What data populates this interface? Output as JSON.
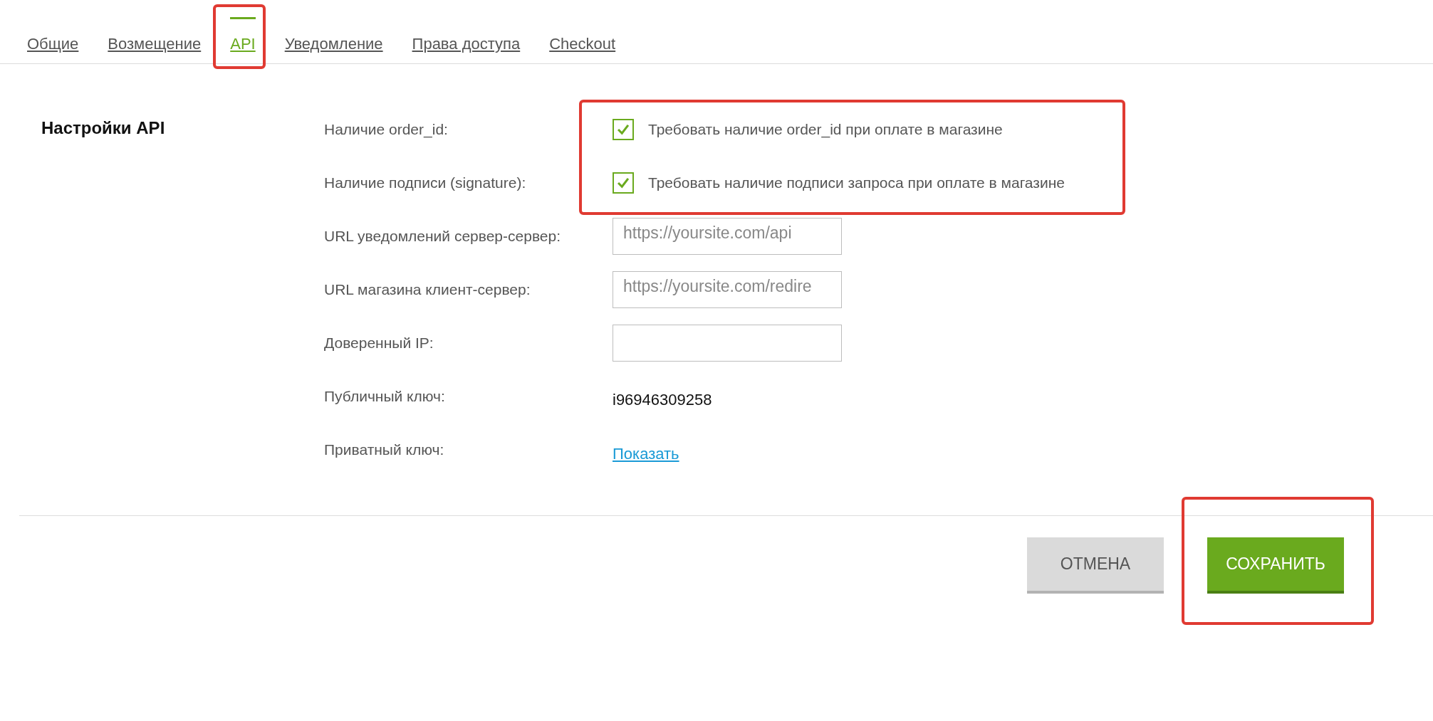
{
  "tabs": [
    {
      "label": "Общие",
      "selected": false,
      "highlighted": false
    },
    {
      "label": "Возмещение",
      "selected": false,
      "highlighted": false
    },
    {
      "label": "API",
      "selected": true,
      "highlighted": true
    },
    {
      "label": "Уведомление",
      "selected": false,
      "highlighted": false
    },
    {
      "label": "Права доступа",
      "selected": false,
      "highlighted": false
    },
    {
      "label": "Checkout",
      "selected": false,
      "highlighted": false
    }
  ],
  "section": {
    "title": "Настройки API",
    "checkbox_group": {
      "highlighted": true,
      "rows": [
        {
          "label": "Наличие order_id:",
          "text": "Требовать наличие order_id при оплате в магазине",
          "checked": true
        },
        {
          "label": "Наличие подписи (signature):",
          "text": "Требовать наличие подписи запроса при оплате в магазине",
          "checked": true
        }
      ]
    },
    "fields": [
      {
        "kind": "input",
        "label": "URL уведомлений сервер-сервер:",
        "placeholder": "https://yoursite.com/api"
      },
      {
        "kind": "input",
        "label": "URL магазина клиент-сервер:",
        "placeholder": "https://yoursite.com/redire"
      },
      {
        "kind": "input",
        "label": "Доверенный IP:"
      },
      {
        "kind": "text",
        "label": "Публичный ключ:",
        "value": "i96946309258"
      },
      {
        "kind": "link",
        "label": "Приватный ключ:",
        "value": "Показать"
      }
    ]
  },
  "buttons": [
    {
      "kind": "secondary",
      "label": "ОТМЕНА",
      "highlighted": false
    },
    {
      "kind": "primary",
      "label": "СОХРАНИТЬ",
      "highlighted": true
    }
  ]
}
